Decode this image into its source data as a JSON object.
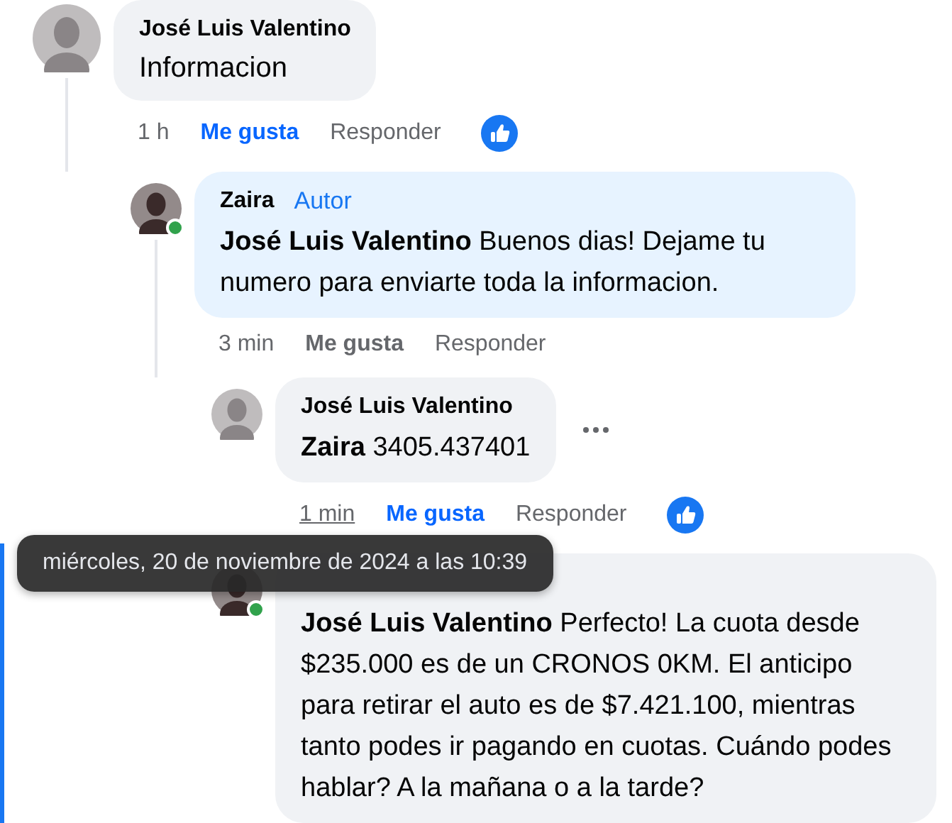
{
  "comments": [
    {
      "author": "José Luis Valentino",
      "body": "Informacion",
      "time": "1 h",
      "time_hovered": false,
      "like": "Me gusta",
      "liked": true,
      "reply": "Responder",
      "reaction": true,
      "online": false,
      "highlighted": false,
      "children": [
        {
          "author": "Zaira",
          "badge": "Autor",
          "body": "**José Luis Valentino** Buenos dias! Dejame tu numero para enviarte toda la informacion.",
          "time": "3 min",
          "time_hovered": false,
          "like": "Me gusta",
          "liked": false,
          "reply": "Responder",
          "reaction": false,
          "online": true,
          "highlighted": false,
          "children": [
            {
              "author": "José Luis Valentino",
              "body": "**Zaira** 3405.437401",
              "more": true,
              "time": "1 min",
              "time_hovered": true,
              "like": "Me gusta",
              "liked": true,
              "reply": "Responder",
              "reaction": true,
              "online": false,
              "highlighted": false
            },
            {
              "body": "**José Luis Valentino** Perfecto! La cuota desde $235.000 es de un CRONOS 0KM. El anticipo para retirar el auto es de $7.421.100, mientras tanto podes ir pagando en cuotas. Cuándo podes hablar? A la mañana o a la tarde?",
              "online": true,
              "highlighted": true
            }
          ]
        }
      ]
    }
  ],
  "tooltip": {
    "text": "miércoles, 20 de noviembre de 2024 a las 10:39"
  }
}
